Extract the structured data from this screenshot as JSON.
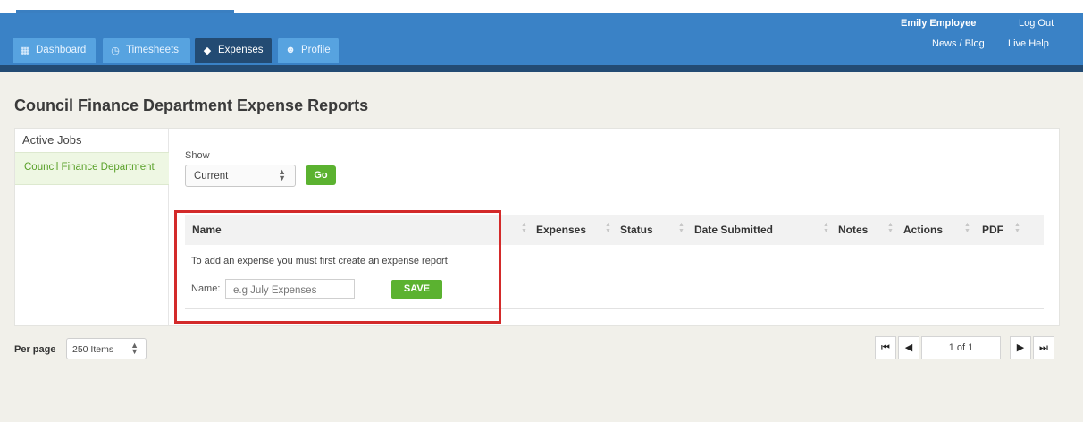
{
  "header": {
    "tabs": [
      {
        "label": "Dashboard",
        "icon": "grid-icon"
      },
      {
        "label": "Timesheets",
        "icon": "clock-icon"
      },
      {
        "label": "Expenses",
        "icon": "tag-icon",
        "active": true
      },
      {
        "label": "Profile",
        "icon": "user-icon"
      }
    ],
    "user_name": "Emily Employee",
    "logout_label": "Log Out",
    "news_label": "News / Blog",
    "help_label": "Live Help"
  },
  "page": {
    "title": "Council Finance Department Expense Reports"
  },
  "sidebar": {
    "heading": "Active Jobs",
    "items": [
      {
        "label": "Council Finance Department",
        "selected": true
      }
    ]
  },
  "filter": {
    "show_label": "Show",
    "selected_value": "Current",
    "go_label": "Go"
  },
  "table": {
    "columns": [
      "Name",
      "Expenses",
      "Status",
      "Date Submitted",
      "Notes",
      "Actions",
      "PDF"
    ]
  },
  "create_report": {
    "hint": "To add an expense you must first create an expense report",
    "name_label": "Name:",
    "name_placeholder": "e.g July Expenses",
    "save_label": "SAVE"
  },
  "footer": {
    "per_page_label": "Per page",
    "per_page_value": "250 Items",
    "page_info": "1 of 1"
  },
  "colors": {
    "header_blue": "#3a82c6",
    "header_dark": "#234b73",
    "accent_green": "#5bb230",
    "highlight_red": "#d32a2a"
  }
}
